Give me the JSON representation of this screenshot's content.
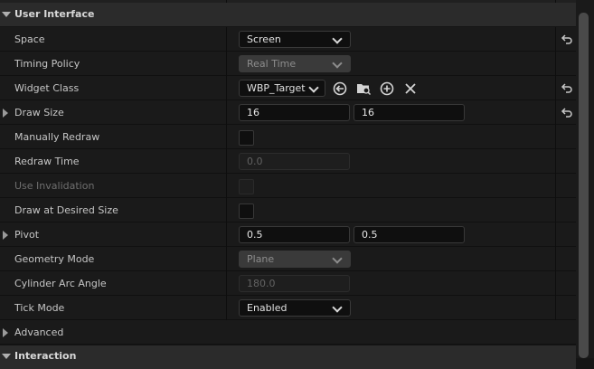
{
  "categories": {
    "user_interface": "User Interface",
    "interaction": "Interaction"
  },
  "properties": {
    "space": {
      "label": "Space",
      "value": "Screen"
    },
    "timing_policy": {
      "label": "Timing Policy",
      "value": "Real Time"
    },
    "widget_class": {
      "label": "Widget Class",
      "value": "WBP_Target"
    },
    "draw_size": {
      "label": "Draw Size",
      "x": "16",
      "y": "16"
    },
    "manually_redraw": {
      "label": "Manually Redraw",
      "checked": false
    },
    "redraw_time": {
      "label": "Redraw Time",
      "value": "0.0"
    },
    "use_invalidation": {
      "label": "Use Invalidation",
      "checked": false
    },
    "draw_at_desired_size": {
      "label": "Draw at Desired Size",
      "checked": false
    },
    "pivot": {
      "label": "Pivot",
      "x": "0.5",
      "y": "0.5"
    },
    "geometry_mode": {
      "label": "Geometry Mode",
      "value": "Plane"
    },
    "cylinder_arc_angle": {
      "label": "Cylinder Arc Angle",
      "value": "180.0"
    },
    "tick_mode": {
      "label": "Tick Mode",
      "value": "Enabled"
    },
    "advanced": {
      "label": "Advanced"
    }
  },
  "icons": {
    "reset": "reset-to-default-arrow",
    "browse": "use-selected-arrow",
    "find": "browse-folder-magnifier",
    "add": "plus-circle",
    "clear": "x-cross"
  },
  "colors": {
    "background": "#151515",
    "category_bg": "#2b2b2b",
    "row_bg": "#1a1a1a",
    "input_bg": "#0f0f0f",
    "disabled_combo_bg": "#3a3a3a",
    "text": "#c6c6c6",
    "disabled_text": "#6f6f6f"
  }
}
